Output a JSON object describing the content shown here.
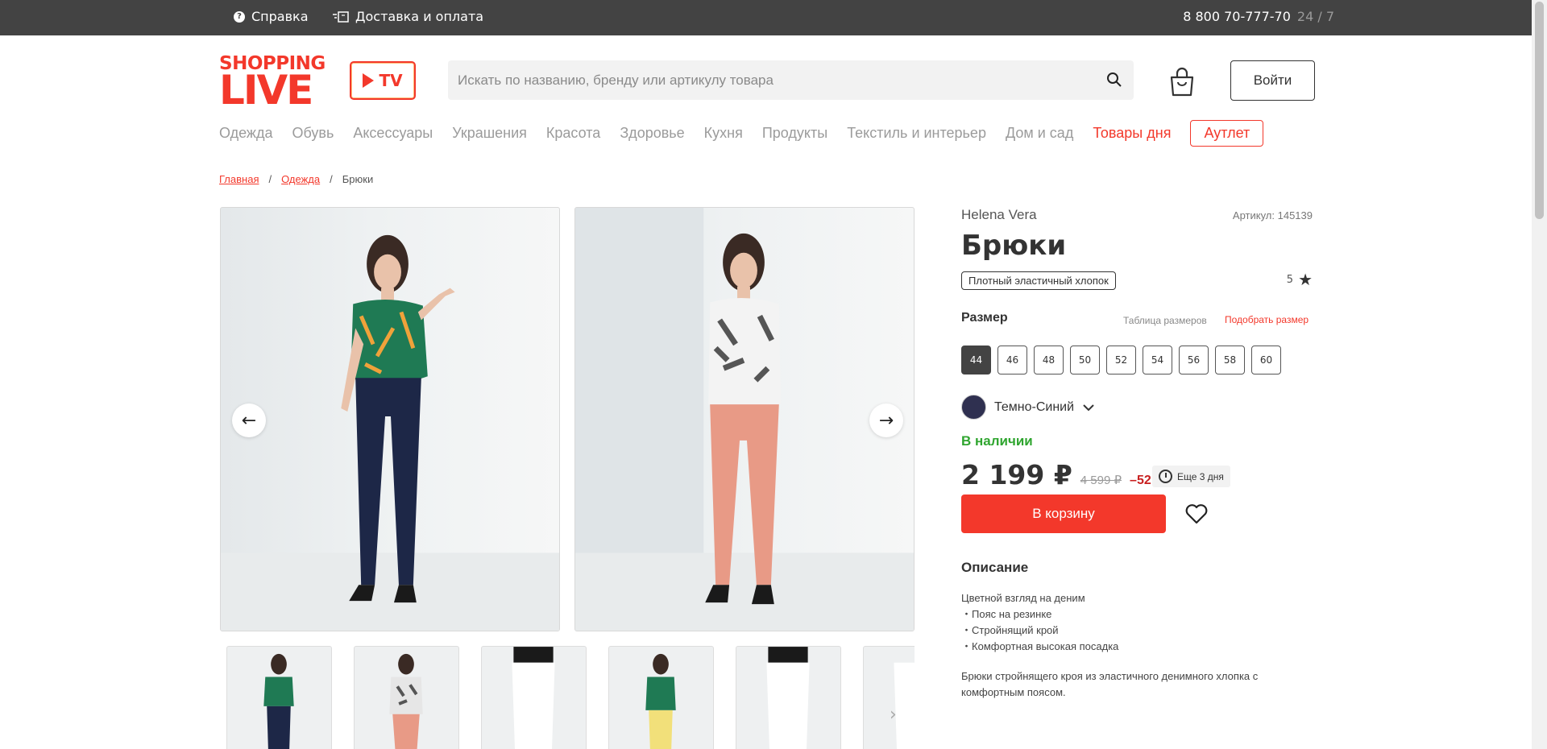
{
  "topbar": {
    "help_label": "Справка",
    "delivery_label": "Доставка и оплата",
    "phone": "8 800 70-777-70",
    "hours": "24 / 7"
  },
  "header": {
    "logo_top": "SHOPPING",
    "logo_bottom": "LIVE",
    "tv_label": "TV",
    "search_placeholder": "Искать по названию, бренду или артикулу товара",
    "login_label": "Войти"
  },
  "nav": {
    "items": [
      "Одежда",
      "Обувь",
      "Аксессуары",
      "Украшения",
      "Красота",
      "Здоровье",
      "Кухня",
      "Продукты",
      "Текстиль и интерьер",
      "Дом и сад"
    ],
    "hot": "Товары дня",
    "outlet": "Аутлет"
  },
  "breadcrumbs": {
    "home": "Главная",
    "category": "Одежда",
    "current": "Брюки",
    "sep": "/"
  },
  "product": {
    "brand": "Helena Vera",
    "article": "Артикул: 145139",
    "title": "Брюки",
    "tag": "Плотный эластичный хлопок",
    "rating": "5",
    "size_label": "Размер",
    "size_table": "Таблица размеров",
    "size_pick": "Подобрать размер",
    "sizes": [
      "44",
      "46",
      "48",
      "50",
      "52",
      "54",
      "56",
      "58",
      "60"
    ],
    "selected_size": "44",
    "color_name": "Темно-Синий",
    "color_hex": "#2f3050",
    "stock": "В наличии",
    "price": "2 199 ₽",
    "old_price": "4 599 ₽",
    "discount": "–52 %",
    "timer": "Еще 3 дня",
    "cart_label": "В корзину",
    "description_title": "Описание",
    "description_lead": "Цветной взгляд на деним",
    "description_points": [
      "Пояс на резинке",
      "Стройнящий крой",
      "Комфортная высокая посадка"
    ],
    "description_text": "Брюки стройнящего кроя из эластичного денимного хлопка с комфортным поясом."
  },
  "colors": {
    "accent": "#f3382b",
    "topbar": "#434343",
    "in_stock": "#2fa52f",
    "discount": "#c81f1f"
  }
}
